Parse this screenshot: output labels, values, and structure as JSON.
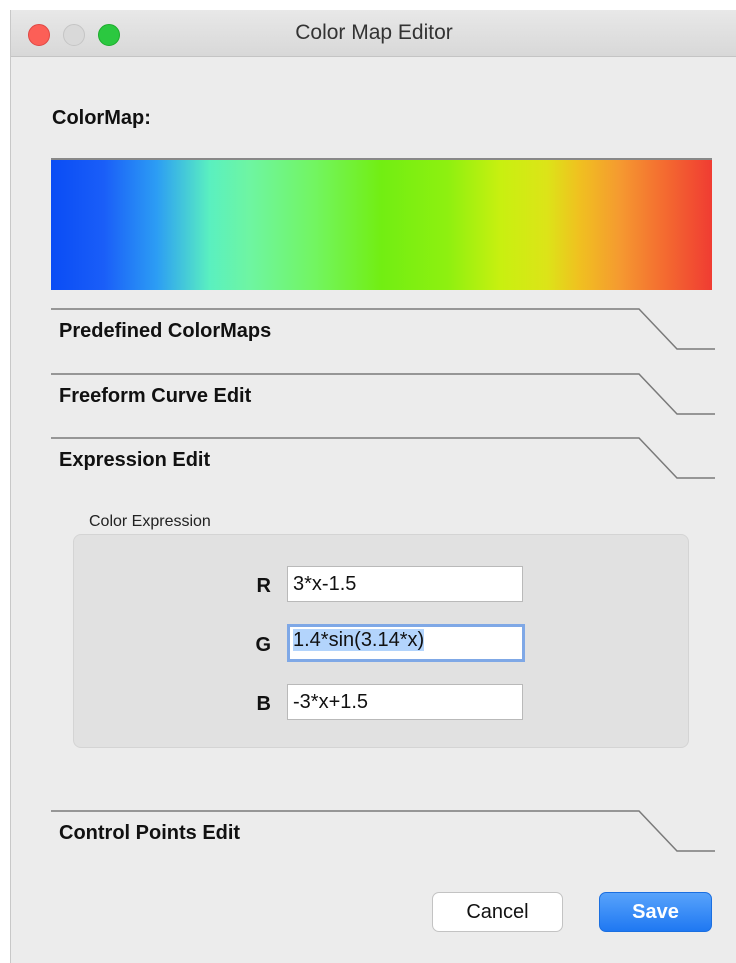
{
  "window": {
    "title": "Color Map Editor"
  },
  "colormap": {
    "label": "ColorMap:"
  },
  "sections": {
    "predefined": "Predefined ColorMaps",
    "freeform": "Freeform Curve Edit",
    "expression": "Expression Edit",
    "control_points": "Control Points Edit"
  },
  "expression": {
    "group_label": "Color Expression",
    "r_label": "R",
    "r_value": "3*x-1.5",
    "g_label": "G",
    "g_value": "1.4*sin(3.14*x)",
    "b_label": "B",
    "b_value": "-3*x+1.5"
  },
  "buttons": {
    "cancel": "Cancel",
    "save": "Save"
  },
  "colors": {
    "accent": "#1f78f2",
    "close": "#fc5f57",
    "maximize": "#2bc840"
  }
}
